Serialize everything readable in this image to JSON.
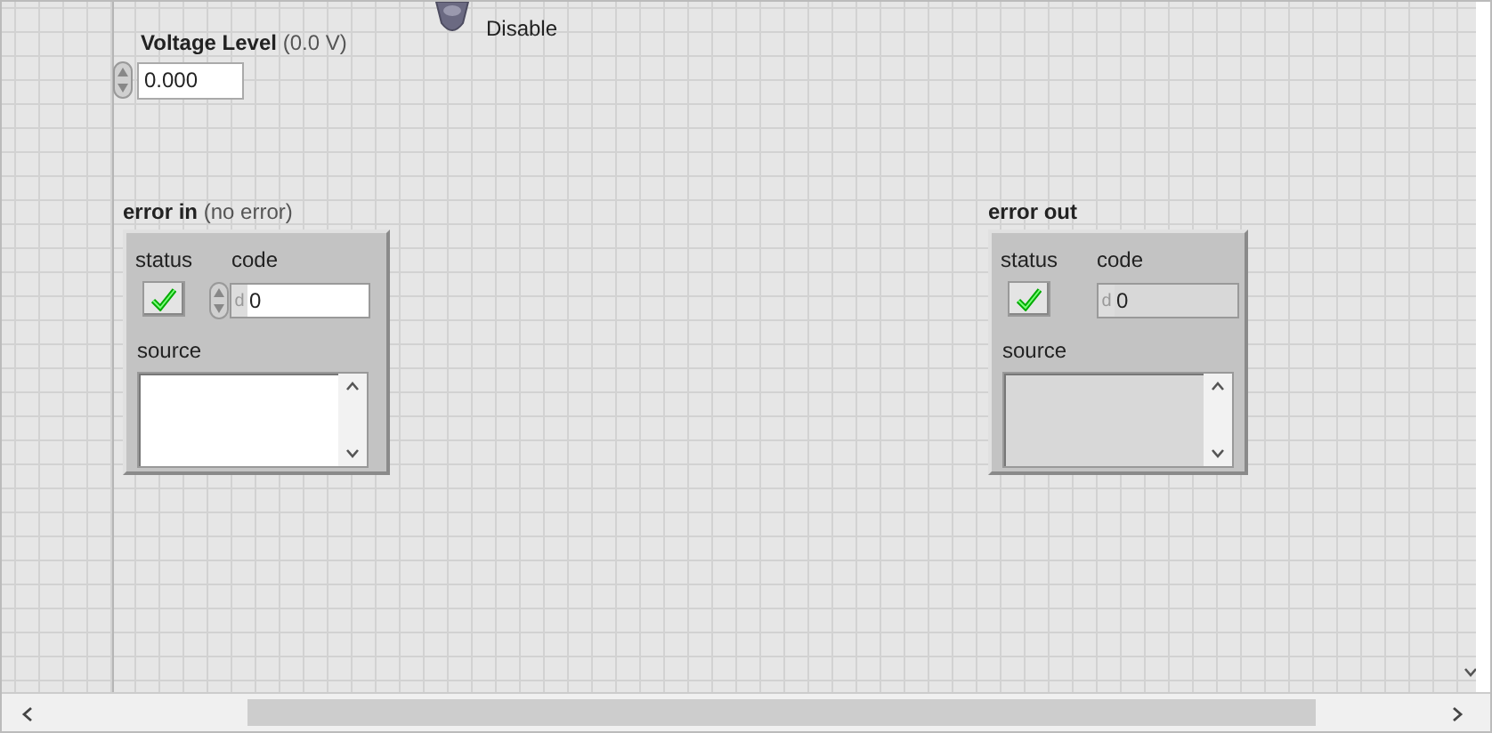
{
  "voltage_level": {
    "label": "Voltage Level",
    "note": "(0.0 V)",
    "value": "0.000"
  },
  "disable_switch": {
    "label": "Disable"
  },
  "clusters": [
    {
      "kind": "control",
      "label": "error in",
      "note": "(no error)",
      "status_label": "status",
      "error": false,
      "code_label": "code",
      "radix": "d",
      "code": "0",
      "source_label": "source"
    },
    {
      "kind": "indicator",
      "label": "error out",
      "status_label": "status",
      "error": false,
      "code_label": "code",
      "radix": "d",
      "code": "0",
      "source_label": "source"
    }
  ]
}
